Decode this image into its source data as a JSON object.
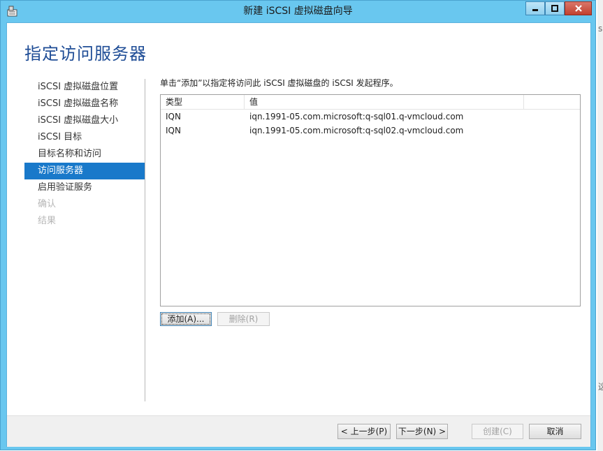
{
  "window": {
    "title": "新建 iSCSI 虚拟磁盘向导",
    "icons": {
      "app": "wizard-icon",
      "minimize": "minimize-icon",
      "maximize": "maximize-icon",
      "close": "close-icon"
    }
  },
  "page": {
    "title": "指定访问服务器",
    "instruction": "单击“添加”以指定将访问此 iSCSI 虚拟磁盘的 iSCSI 发起程序。"
  },
  "nav": {
    "items": [
      {
        "label": "iSCSI 虚拟磁盘位置",
        "state": "normal"
      },
      {
        "label": "iSCSI 虚拟磁盘名称",
        "state": "normal"
      },
      {
        "label": "iSCSI 虚拟磁盘大小",
        "state": "normal"
      },
      {
        "label": "iSCSI 目标",
        "state": "normal"
      },
      {
        "label": "目标名称和访问",
        "state": "normal"
      },
      {
        "label": "访问服务器",
        "state": "active"
      },
      {
        "label": "启用验证服务",
        "state": "normal"
      },
      {
        "label": "确认",
        "state": "disabled"
      },
      {
        "label": "结果",
        "state": "disabled"
      }
    ]
  },
  "grid": {
    "columns": [
      "类型",
      "值",
      ""
    ],
    "rows": [
      {
        "type": "IQN",
        "value": "iqn.1991-05.com.microsoft:q-sql01.q-vmcloud.com"
      },
      {
        "type": "IQN",
        "value": "iqn.1991-05.com.microsoft:q-sql02.q-vmcloud.com"
      }
    ]
  },
  "actions": {
    "add_label": "添加(A)...",
    "remove_label": "删除(R)"
  },
  "footer": {
    "prev_label": "< 上一步(P)",
    "next_label": "下一步(N) >",
    "create_label": "创建(C)",
    "cancel_label": "取消"
  },
  "background": {
    "edge_glyph_top": "s",
    "edge_glyph_bottom": "这"
  },
  "colors": {
    "titlebar": "#69c7ef",
    "accent": "#1979ca",
    "page_title": "#1f4d96",
    "close": "#c7483a"
  }
}
